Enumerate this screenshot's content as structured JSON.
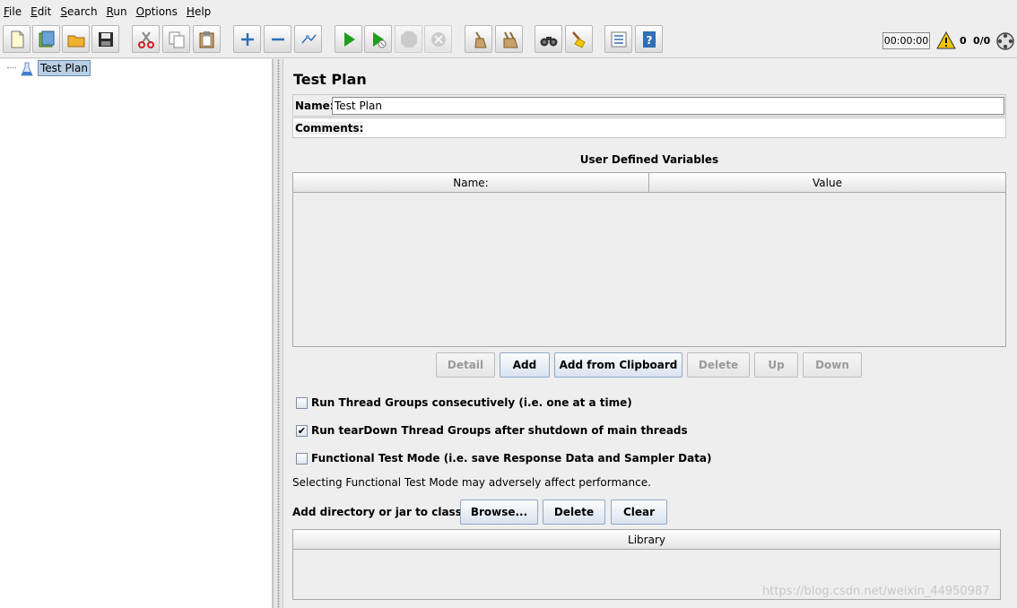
{
  "menu": [
    {
      "label": "File"
    },
    {
      "label": "Edit"
    },
    {
      "label": "Search"
    },
    {
      "label": "Run"
    },
    {
      "label": "Options"
    },
    {
      "label": "Help"
    }
  ],
  "toolbar": {
    "buttons": [
      {
        "icon": "new-icon"
      },
      {
        "icon": "templates-icon"
      },
      {
        "icon": "open-icon"
      },
      {
        "icon": "save-icon"
      },
      {
        "icon": "cut-icon"
      },
      {
        "icon": "copy-icon"
      },
      {
        "icon": "paste-icon"
      },
      {
        "icon": "expand-icon"
      },
      {
        "icon": "collapse-icon"
      },
      {
        "icon": "toggle-icon"
      },
      {
        "icon": "start-icon"
      },
      {
        "icon": "start-no-pauses-icon"
      },
      {
        "icon": "stop-icon"
      },
      {
        "icon": "shutdown-icon"
      },
      {
        "icon": "clear-icon"
      },
      {
        "icon": "clear-all-icon"
      },
      {
        "icon": "search-icon"
      },
      {
        "icon": "reset-search-icon"
      },
      {
        "icon": "function-helper-icon"
      },
      {
        "icon": "help-icon"
      }
    ],
    "timer": "00:00:00",
    "warning_count": "0",
    "thread_count": "0/0"
  },
  "tree": {
    "root_label": "Test Plan"
  },
  "test_plan": {
    "title": "Test Plan",
    "name_label": "Name:",
    "name_value": "Test Plan",
    "comments_label": "Comments:",
    "udv_title": "User Defined Variables",
    "udv_columns": [
      "Name:",
      "Value"
    ],
    "udv_buttons": {
      "detail": "Detail",
      "add": "Add",
      "add_from_clipboard": "Add from Clipboard",
      "delete": "Delete",
      "up": "Up",
      "down": "Down"
    },
    "options": [
      {
        "label": "Run Thread Groups consecutively (i.e. one at a time)",
        "checked": false
      },
      {
        "label": "Run tearDown Thread Groups after shutdown of main threads",
        "checked": true
      },
      {
        "label": "Functional Test Mode (i.e. save Response Data and Sampler Data)",
        "checked": false
      }
    ],
    "perf_note": "Selecting Functional Test Mode may adversely affect performance.",
    "classpath_label": "Add directory or jar to classpath",
    "classpath_buttons": {
      "browse": "Browse...",
      "delete": "Delete",
      "clear": "Clear"
    },
    "library_column": "Library"
  },
  "watermark": "https://blog.csdn.net/weixin_44950987",
  "colors": {
    "selection": "#b8cfe5",
    "play_green": "#1e9e1e",
    "warning_yellow": "#f2c500"
  }
}
